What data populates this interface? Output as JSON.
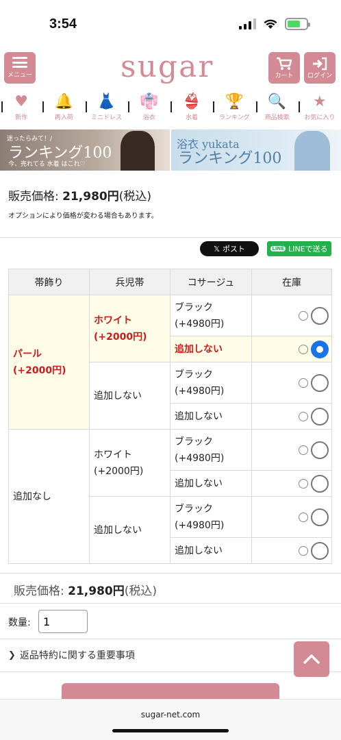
{
  "status_bar": {
    "time": "3:54"
  },
  "header": {
    "menu_label": "メニュー",
    "logo": "sugar",
    "cart_label": "カート",
    "login_label": "ログイン"
  },
  "nav": [
    {
      "label": "新作",
      "icon": "heart-icon",
      "glyph": "♥"
    },
    {
      "label": "再入荷",
      "icon": "bell-icon",
      "glyph": "🔔"
    },
    {
      "label": "ミニドレス",
      "icon": "dress-icon",
      "glyph": "👗"
    },
    {
      "label": "浴衣",
      "icon": "kimono-icon",
      "glyph": "👘"
    },
    {
      "label": "水着",
      "icon": "bikini-icon",
      "glyph": "👙"
    },
    {
      "label": "ランキング",
      "icon": "trophy-icon",
      "glyph": "🏆"
    },
    {
      "label": "商品検索",
      "icon": "search-icon",
      "glyph": "🔍"
    },
    {
      "label": "お気に入り",
      "icon": "star-icon",
      "glyph": "★"
    }
  ],
  "banners": {
    "left": {
      "small": "迷ったらみて！/",
      "big": "ランキング100",
      "sub": "今、売れてる 水着 はこれ♡"
    },
    "right": {
      "small": "浴衣 yukata",
      "big": "ランキング100"
    }
  },
  "price": {
    "label": "販売価格:",
    "value": "21,980円",
    "tax": "(税込)",
    "note": "オプションにより価格が変わる場合もあります。"
  },
  "share": {
    "x_label": "ポスト",
    "x_glyph": "𝕏",
    "line_label": "LINEで送る",
    "line_badge": "LINE"
  },
  "table": {
    "headers": [
      "帯飾り",
      "兵児帯",
      "コサージュ",
      "在庫"
    ],
    "obi_pearl": "パール\n(+2000円)",
    "obi_none": "追加なし",
    "heko_white_1": "ホワイト\n(+2000円)",
    "heko_none_1": "追加しない",
    "heko_white_2": "ホワイト\n(+2000円)",
    "heko_none_2": "追加しない",
    "corsage_black": "ブラック\n(+4980円)",
    "corsage_none": "追加しない"
  },
  "bottom": {
    "price_label": "販売価格:",
    "price_value": "21,980円",
    "price_tax": "(税込)",
    "qty_label": "数量:",
    "qty_value": "1",
    "returns_link": "返品特約に関する重要事項",
    "footer_url": "sugar-net.com"
  },
  "colors": {
    "brand_pink": "#d48a94",
    "highlight_red": "#cc1b1b",
    "radio_blue": "#1a73e8",
    "line_green": "#22b14c"
  }
}
